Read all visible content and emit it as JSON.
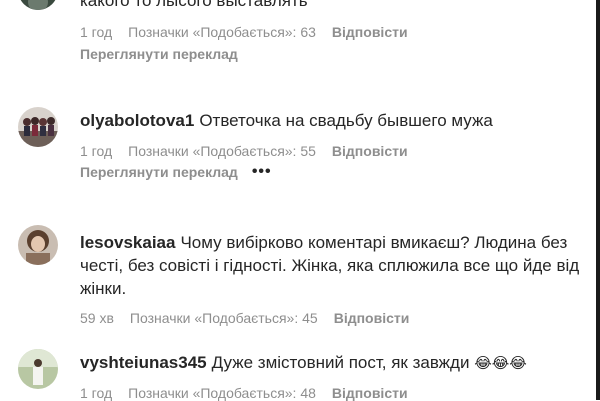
{
  "comments": [
    {
      "text": "какого то лысого выставлять",
      "time": "1 год",
      "likes": "Позначки «Подобається»: 63",
      "reply": "Відповісти",
      "translate": "Переглянути переклад"
    },
    {
      "username": "olyabolotova1",
      "text": "Ответочка на свадьбу бывшего мужа",
      "time": "1 год",
      "likes": "Позначки «Подобається»: 55",
      "reply": "Відповісти",
      "translate": "Переглянути переклад"
    },
    {
      "username": "lesovskaiaa",
      "text": "Чому вибірково коментарі вмикаєш? Людина без честі, без совісті і гідності. Жінка, яка сплюжила все що йде від жінки.",
      "time": "59 хв",
      "likes": "Позначки «Подобається»: 45",
      "reply": "Відповісти"
    },
    {
      "username": "vyshteiunas345",
      "text": "Дуже змістовний пост, як завжди",
      "emoji": "😂😂😂",
      "time": "1 год",
      "likes": "Позначки «Подобається»: 48",
      "reply": "Відповісти"
    }
  ],
  "icons": {
    "more": "more-options-icon"
  },
  "colors": {
    "text": "#262626",
    "secondary": "#8e8e8e",
    "background": "#ffffff"
  }
}
